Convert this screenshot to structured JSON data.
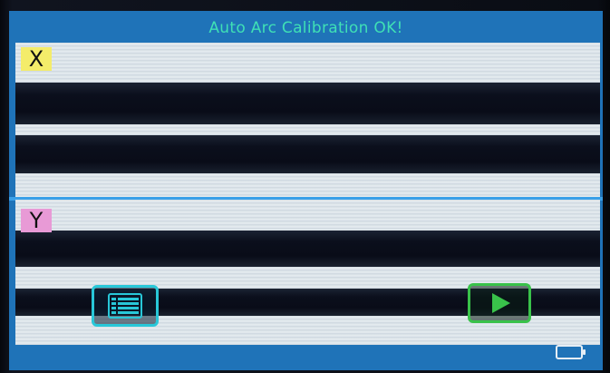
{
  "header": {
    "title": "Auto Arc Calibration OK!"
  },
  "views": {
    "x_label": "X",
    "y_label": "Y"
  },
  "buttons": {
    "menu_icon": "list-menu-icon",
    "start_icon": "play-icon"
  },
  "status": {
    "battery_icon": "battery-icon"
  },
  "colors": {
    "title_text": "#3fe0b5",
    "screen_bg": "#1f73b8",
    "x_label_bg": "#f4ec6a",
    "y_label_bg": "#e89ad6",
    "menu_button_accent": "#28c7d8",
    "start_button_accent": "#39c24a"
  }
}
